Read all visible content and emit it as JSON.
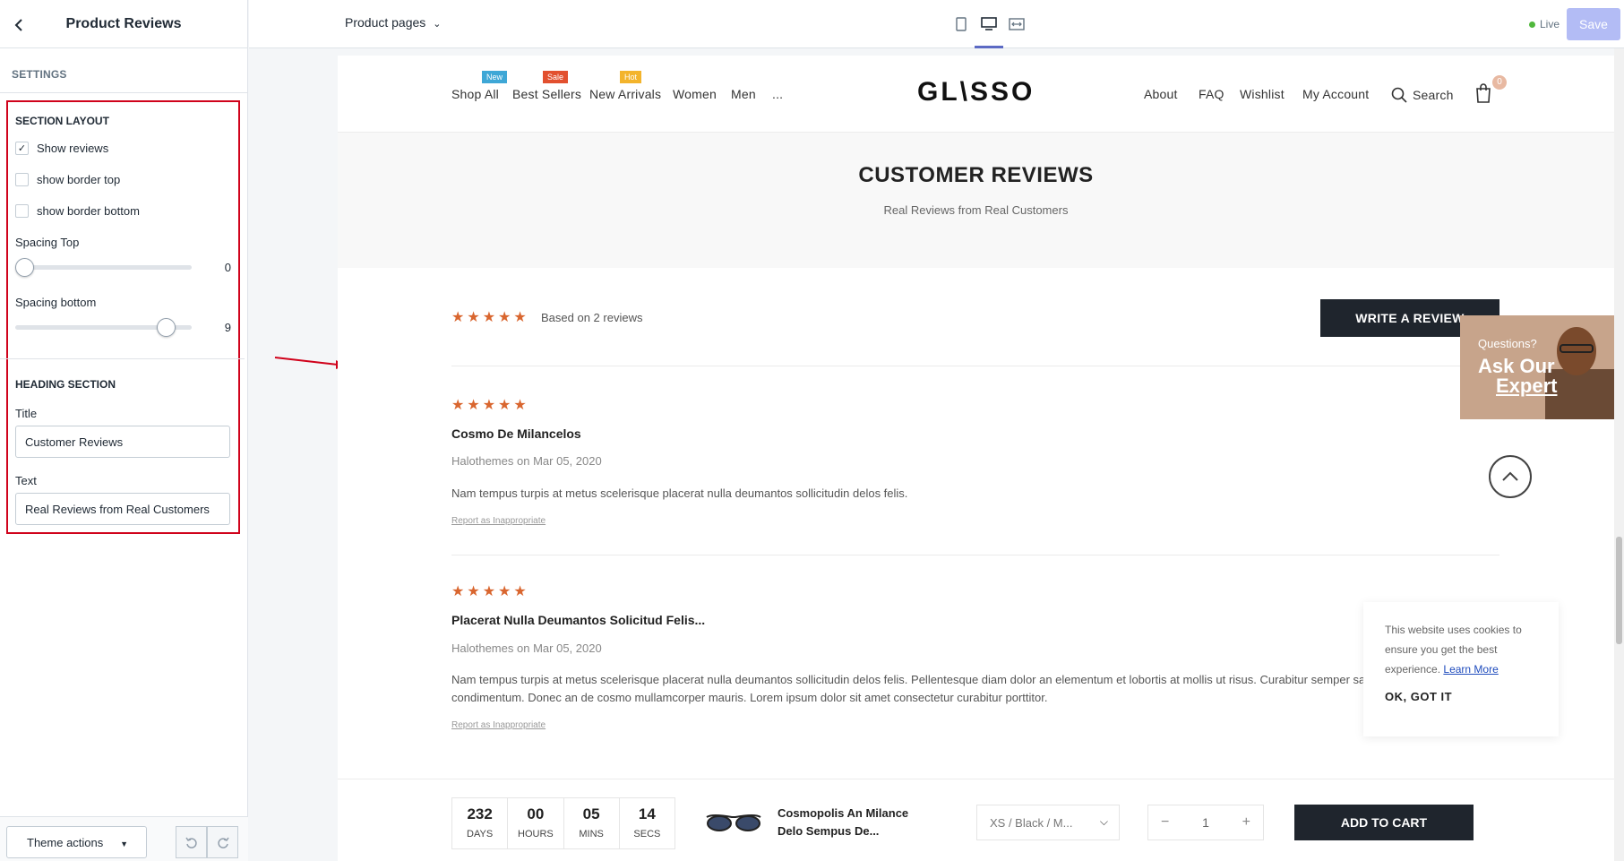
{
  "sidebar": {
    "title": "Product Reviews",
    "settings_label": "SETTINGS",
    "section_layout": {
      "heading": "SECTION LAYOUT",
      "show_reviews": {
        "label": "Show reviews",
        "checked": true
      },
      "show_border_top": {
        "label": "show border top",
        "checked": false
      },
      "show_border_bottom": {
        "label": "show border bottom",
        "checked": false
      },
      "spacing_top": {
        "label": "Spacing Top",
        "value": "0",
        "fraction": 0
      },
      "spacing_bottom": {
        "label": "Spacing bottom",
        "value": "9",
        "fraction": 0.9
      }
    },
    "heading_section": {
      "heading": "HEADING SECTION",
      "title_label": "Title",
      "title_value": "Customer Reviews",
      "text_label": "Text",
      "text_value": "Real Reviews from Real Customers"
    },
    "footer": {
      "theme_actions": "Theme actions"
    }
  },
  "topbar": {
    "page_selector": "Product pages",
    "live_label": "Live",
    "save_label": "Save",
    "live_color": "#50b83c",
    "accent": "#5c6ac4"
  },
  "store": {
    "nav": [
      {
        "label": "Shop All",
        "badge": "New",
        "badge_color": "#3ea7d6"
      },
      {
        "label": "Best Sellers",
        "badge": "Sale",
        "badge_color": "#e2502f"
      },
      {
        "label": "New Arrivals",
        "badge": "Hot",
        "badge_color": "#f3b42c"
      },
      {
        "label": "Women"
      },
      {
        "label": "Men"
      },
      {
        "label": "..."
      }
    ],
    "logo": "GL\\SSO",
    "right_nav": [
      "About",
      "FAQ",
      "Wishlist",
      "My Account"
    ],
    "search_label": "Search",
    "cart_count": "0"
  },
  "reviews": {
    "title": "CUSTOMER REVIEWS",
    "subtitle": "Real Reviews from Real Customers",
    "stars": "★★★★★",
    "based_on": "Based on 2 reviews",
    "write_button": "WRITE A REVIEW",
    "items": [
      {
        "stars": "★★★★★",
        "name": "Cosmo De Milancelos",
        "author": "Halothemes",
        "date_prefix": "on",
        "date": "Mar 05, 2020",
        "body": "Nam tempus turpis at metus scelerisque placerat nulla deumantos sollicitudin delos felis.",
        "report": "Report as Inappropriate"
      },
      {
        "stars": "★★★★★",
        "name": "Placerat Nulla Deumantos Solicitud Felis...",
        "author": "Halothemes",
        "date_prefix": "on",
        "date": "Mar 05, 2020",
        "body": "Nam tempus turpis at metus scelerisque placerat nulla deumantos sollicitudin delos felis. Pellentesque diam dolor an elementum et lobortis at mollis ut risus. Curabitur semper sagittis mino de condimentum. Donec an de cosmo mullamcorper mauris. Lorem ipsum dolor sit amet consectetur curabitur porttitor.",
        "report": "Report as Inappropriate"
      }
    ]
  },
  "expert": {
    "question": "Questions?",
    "line1": "Ask Our",
    "line2": "Expert"
  },
  "cookie": {
    "text": "This website uses cookies to ensure you get the best experience.",
    "link": "Learn More",
    "ok": "OK, GOT IT"
  },
  "sticky": {
    "countdown": [
      {
        "value": "232",
        "label": "DAYS"
      },
      {
        "value": "00",
        "label": "HOURS"
      },
      {
        "value": "05",
        "label": "MINS"
      },
      {
        "value": "14",
        "label": "SECS"
      }
    ],
    "product_name": "Cosmopolis An Milance Delo Sempus De...",
    "variant": "XS / Black / M...",
    "qty": "1",
    "qty_minus": "−",
    "qty_plus": "+",
    "add_to_cart": "ADD TO CART"
  }
}
